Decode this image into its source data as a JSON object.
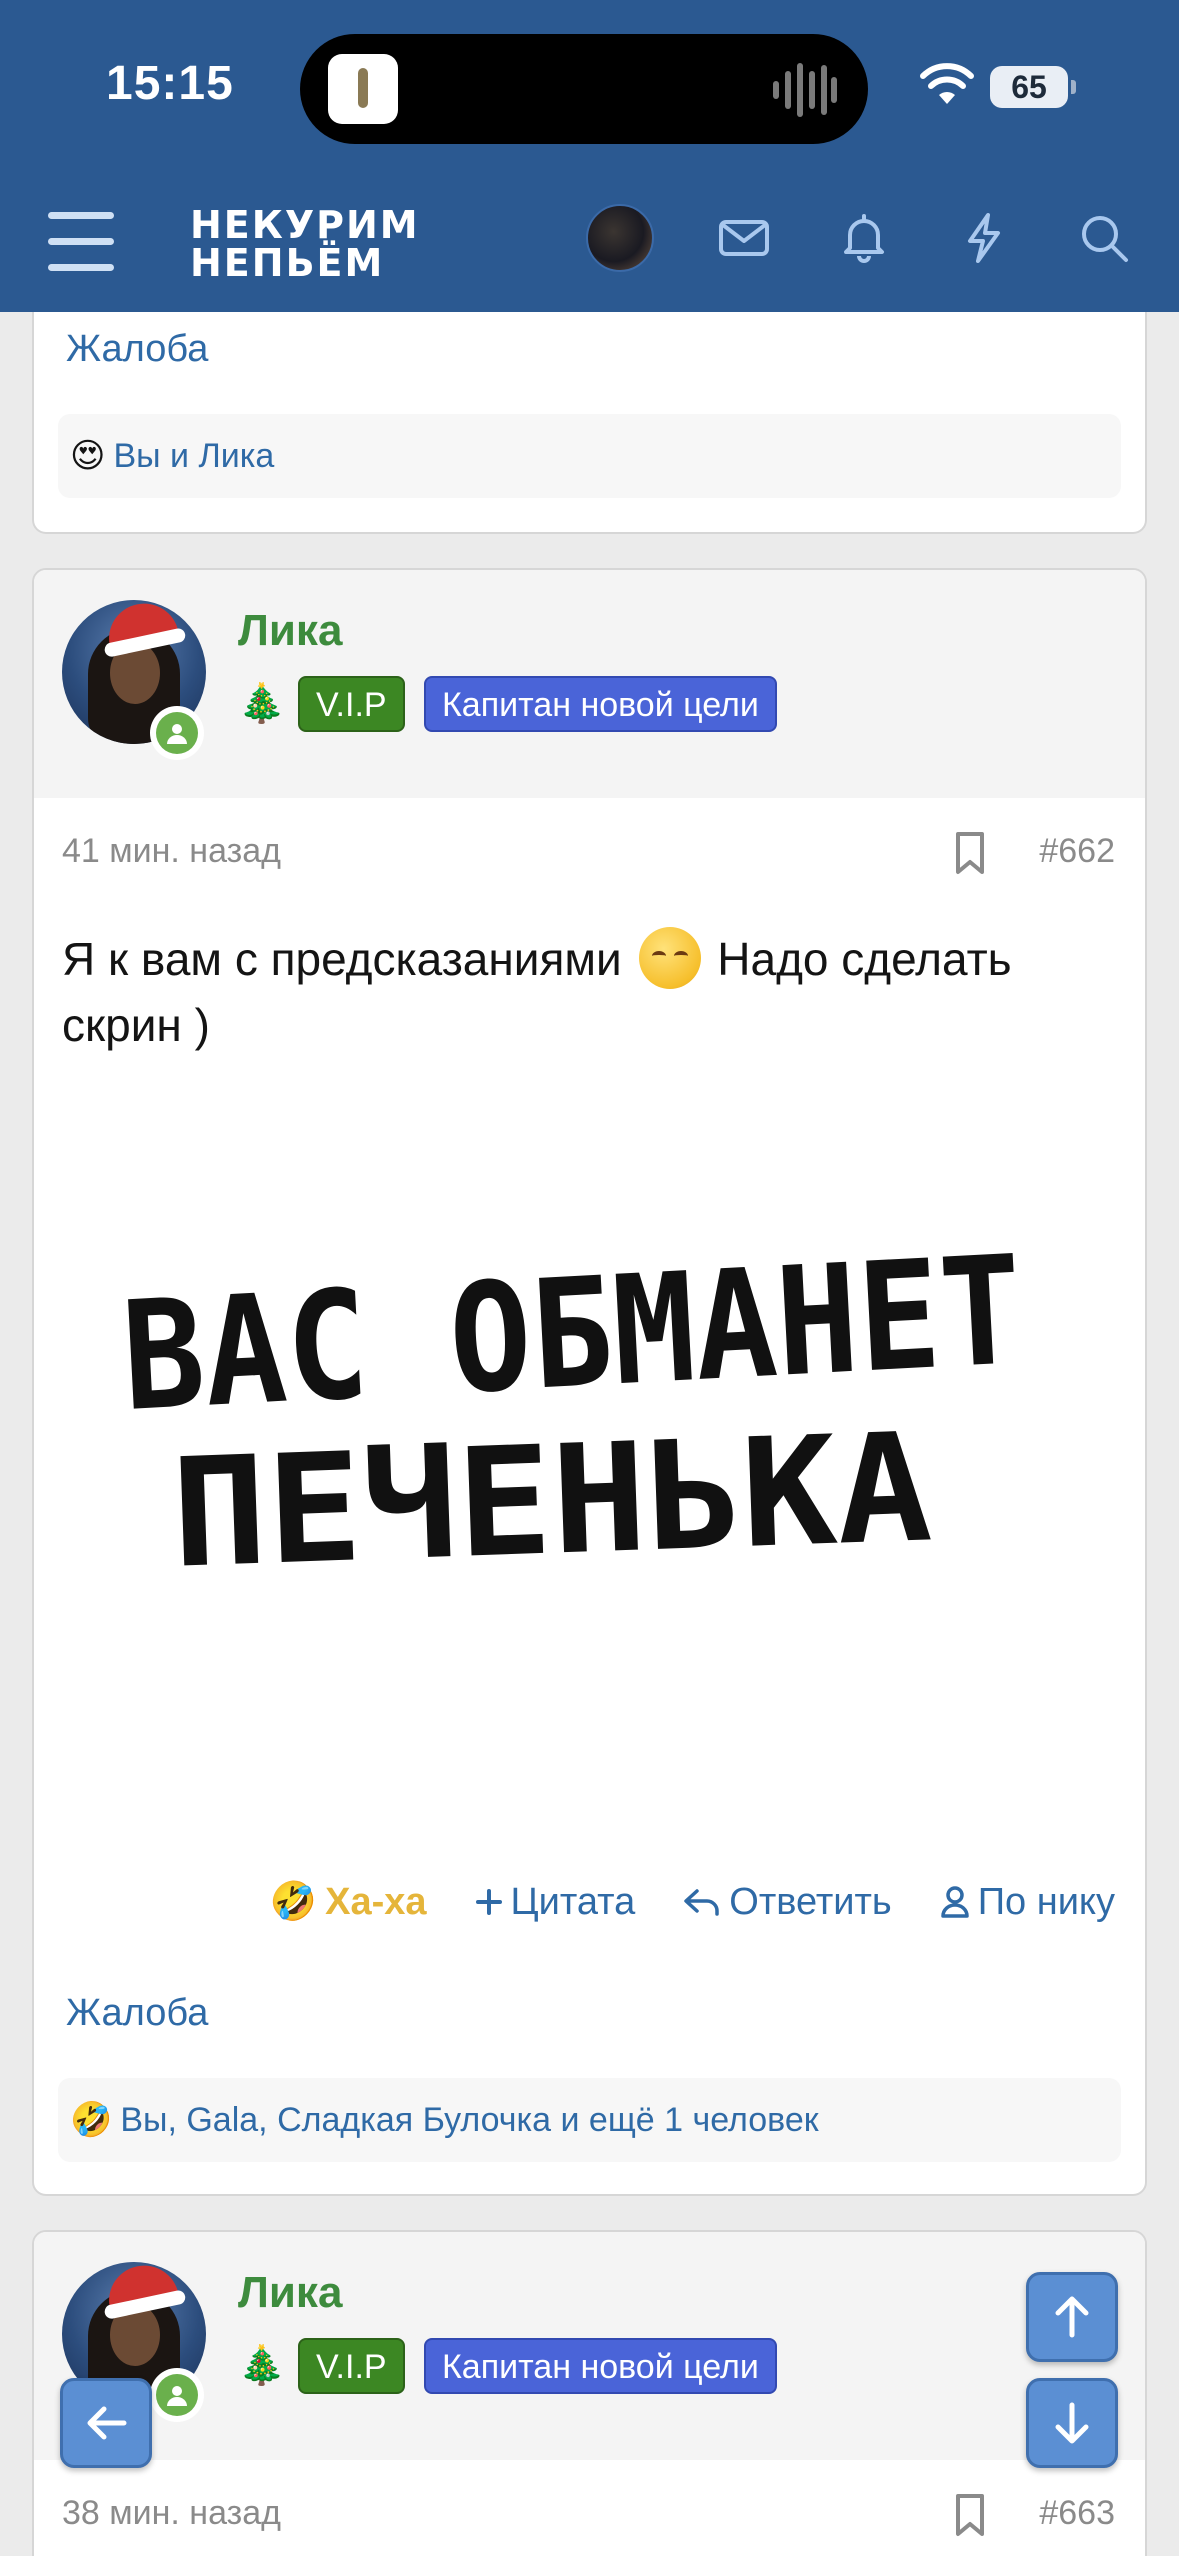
{
  "status_bar": {
    "time": "15:15",
    "battery": "65"
  },
  "header": {
    "logo_line1": "НЕКУРИМ",
    "logo_line2": "НЕПЬЁМ",
    "icons": [
      "menu-icon",
      "user-avatar",
      "mail-icon",
      "bell-icon",
      "lightning-icon",
      "search-icon"
    ]
  },
  "previous_post": {
    "complaint_label": "Жалоба",
    "reactions_summary": "Вы и Лика",
    "reaction_emoji": "😍"
  },
  "post": {
    "username": "Лика",
    "tree_emoji": "🎄",
    "badge_vip": "V.I.P",
    "badge_title": "Капитан новой цели",
    "time_ago": "41 мин. назад",
    "post_number": "#662",
    "text_before_emoji": "Я к вам с предсказаниями",
    "text_after_emoji": "Надо сделать скрин )",
    "image_line1": "ВАС ОБМАНЕТ",
    "image_line2": "ПЕЧЕНЬКА",
    "actions": {
      "haha": "Ха-ха",
      "quote": "Цитата",
      "reply": "Ответить",
      "by_nick": "По нику"
    },
    "haha_emoji": "🤣",
    "complaint_label": "Жалоба",
    "reactions_summary": "Вы, Gala, Сладкая Булочка и ещё 1 человек"
  },
  "next_post": {
    "username": "Лика",
    "tree_emoji": "🎄",
    "badge_vip": "V.I.P",
    "badge_title": "Капитан новой цели",
    "time_ago": "38 мин. назад",
    "post_number": "#663"
  },
  "colors": {
    "header_bg": "#2b5991",
    "link": "#2f6aa6",
    "username": "#3d8b3d",
    "badge_vip": "#3c8723",
    "badge_title": "#4a64d8",
    "haha": "#e5b53a",
    "fab": "#5b8fd3"
  }
}
